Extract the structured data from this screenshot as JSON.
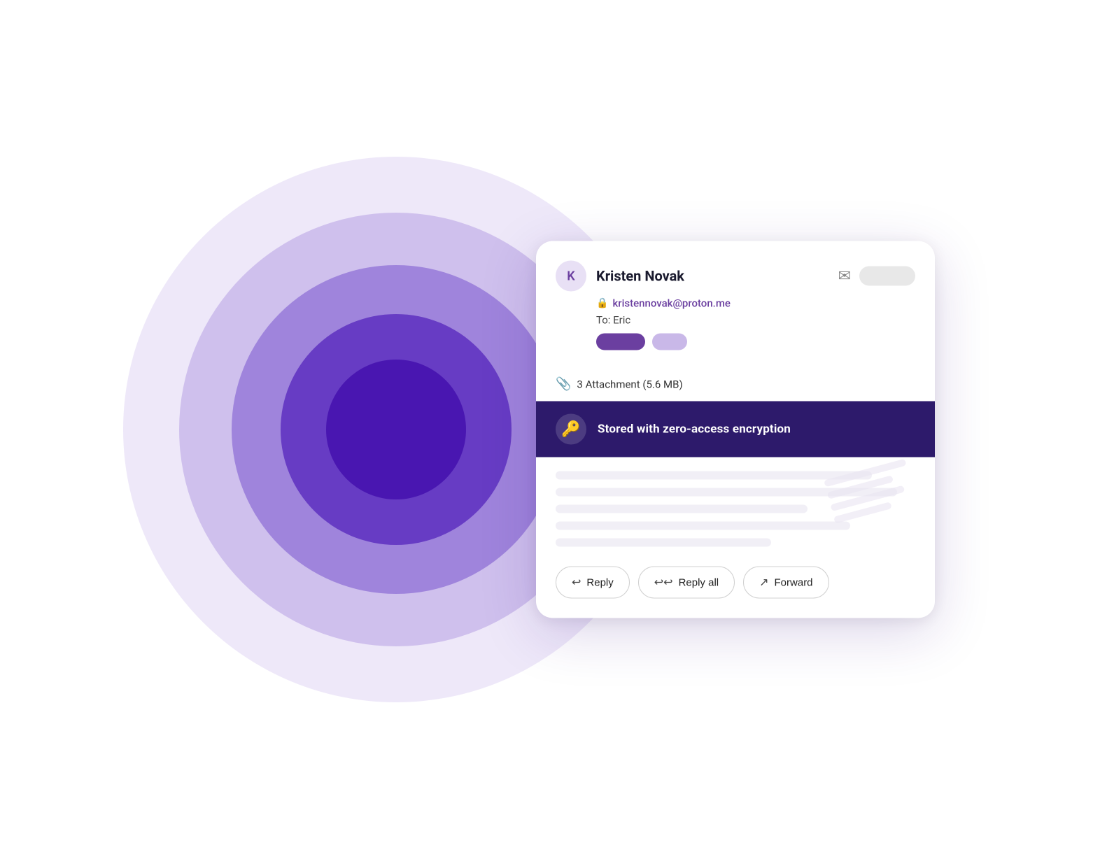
{
  "background": {
    "circles": [
      {
        "size": 780,
        "opacity": 0.18
      },
      {
        "size": 620,
        "opacity": 0.28
      },
      {
        "size": 470,
        "opacity": 0.45
      },
      {
        "size": 330,
        "opacity": 0.7
      },
      {
        "size": 200,
        "opacity": 0.92
      }
    ]
  },
  "email_card": {
    "sender": {
      "avatar_letter": "K",
      "name": "Kristen Novak",
      "email": "kristennovak@proton.me",
      "to_label": "To:",
      "to_name": "Eric"
    },
    "attachment": {
      "label": "3 Attachment (5.6 MB)"
    },
    "encryption": {
      "banner_text": "Stored with zero-access encryption"
    },
    "actions": {
      "reply_label": "Reply",
      "reply_all_label": "Reply all",
      "forward_label": "Forward"
    }
  }
}
